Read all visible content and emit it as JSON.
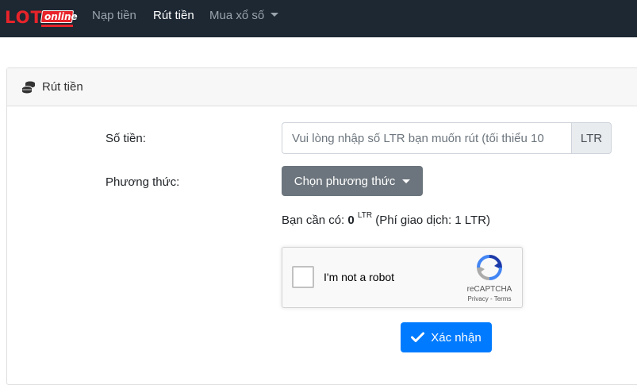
{
  "logo": {
    "text_main": "LOT",
    "text_badge": "online",
    "brand_color": "#e8232a"
  },
  "nav": {
    "items": [
      {
        "label": "Nạp tiền",
        "active": false
      },
      {
        "label": "Rút tiền",
        "active": true
      },
      {
        "label": "Mua xổ số",
        "active": false,
        "dropdown": true
      }
    ],
    "background": "#1d2833"
  },
  "card": {
    "title": "Rút tiền",
    "icon": "coins-icon"
  },
  "form": {
    "amount_label": "Số tiền:",
    "amount_placeholder": "Vui lòng nhập số LTR bạn muốn rút (tối thiểu 10",
    "amount_value": "",
    "amount_unit": "LTR",
    "method_label": "Phương thức:",
    "method_button": "Chọn phương thức",
    "need_prefix": "Bạn cần có: ",
    "need_amount": "0",
    "need_unit": "LTR",
    "need_fee": " (Phí giao dịch: 1 LTR)"
  },
  "captcha": {
    "label": "I'm not a robot",
    "brand": "reCAPTCHA",
    "terms": "Privacy - Terms",
    "checked": false
  },
  "submit": {
    "label": "Xác nhận",
    "icon": "check-icon",
    "color": "#007bff"
  }
}
